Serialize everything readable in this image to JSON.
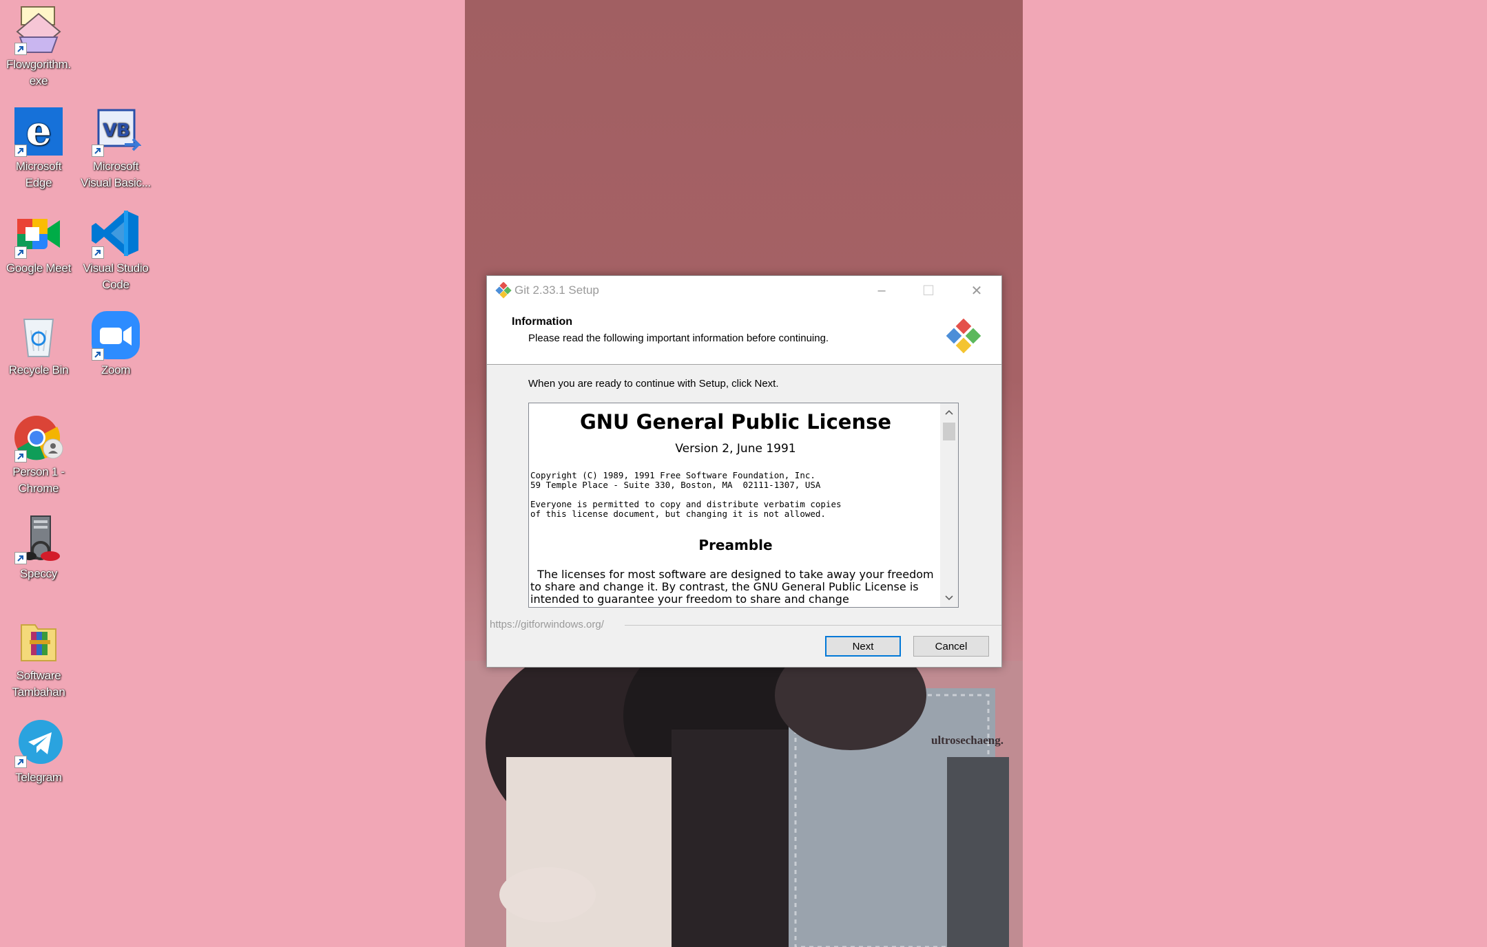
{
  "desktop": {
    "icons": [
      {
        "label": "Flowgorithm.\nexe",
        "icon": "flowgorithm-icon"
      },
      {
        "label": "Microsoft\nEdge",
        "icon": "edge-icon"
      },
      {
        "label": "Microsoft\nVisual Basic...",
        "icon": "visual-basic-icon"
      },
      {
        "label": "Google Meet",
        "icon": "google-meet-icon"
      },
      {
        "label": "Visual Studio\nCode",
        "icon": "vscode-icon"
      },
      {
        "label": "Recycle Bin",
        "icon": "recycle-bin-icon"
      },
      {
        "label": "Zoom",
        "icon": "zoom-icon"
      },
      {
        "label": "Person 1 -\nChrome",
        "icon": "chrome-icon"
      },
      {
        "label": "Speccy",
        "icon": "speccy-icon"
      },
      {
        "label": "Software\nTambahan",
        "icon": "folder-icon"
      },
      {
        "label": "Telegram",
        "icon": "telegram-icon"
      }
    ],
    "wallpaper_watermark": "ultrosechaeng."
  },
  "installer": {
    "title": "Git 2.33.1 Setup",
    "controls": {
      "minimize": "–",
      "maximize": "☐",
      "close": "✕"
    },
    "header_title": "Information",
    "header_subtitle": "Please read the following important information before continuing.",
    "instruction": "When you are ready to continue with Setup, click Next.",
    "license": {
      "title": "GNU General Public License",
      "version": "Version 2, June 1991",
      "copyright_line1": "Copyright (C) 1989, 1991 Free Software Foundation, Inc.",
      "copyright_line2": "59 Temple Place - Suite 330, Boston, MA  02111-1307, USA",
      "permission_line1": "Everyone is permitted to copy and distribute verbatim copies",
      "permission_line2": "of this license document, but changing it is not allowed.",
      "preamble_heading": "Preamble",
      "preamble_text": "  The licenses for most software are designed to take away your freedom to share and change it. By contrast, the GNU General Public License is intended to guarantee your freedom to share and change"
    },
    "footer_url": "https://gitforwindows.org/",
    "next_label": "Next",
    "cancel_label": "Cancel"
  }
}
